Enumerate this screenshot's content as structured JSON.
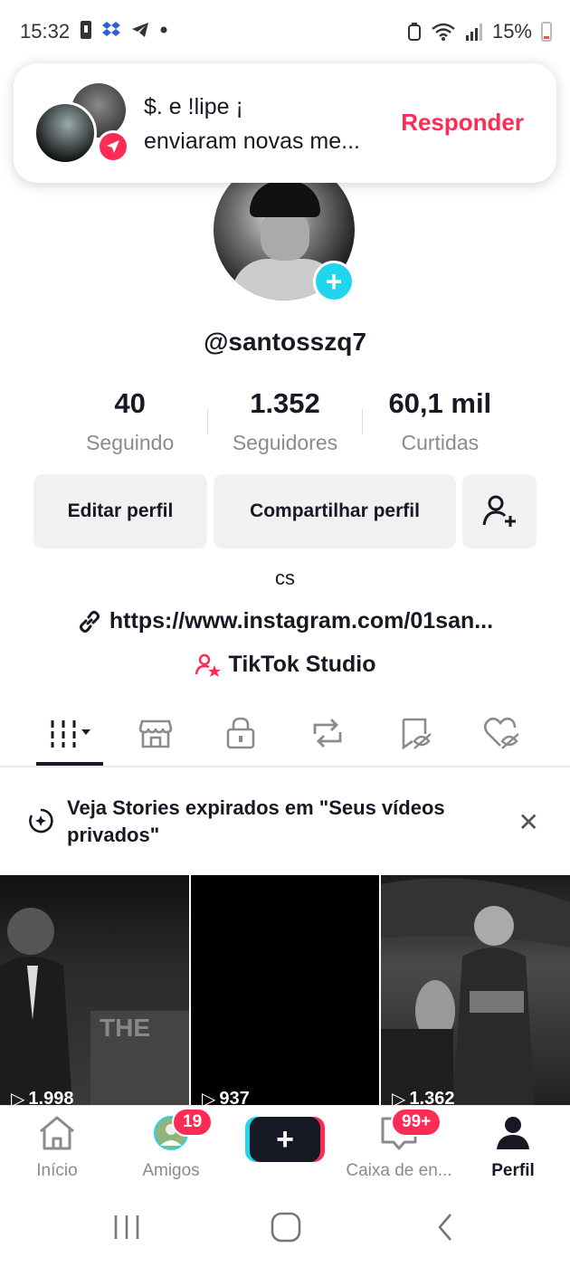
{
  "status_bar": {
    "time": "15:32",
    "battery": "15%",
    "icons": [
      "sim-icon",
      "dropbox-icon",
      "telegram-icon",
      "dot-icon",
      "alarm-icon",
      "wifi-icon",
      "signal-icon",
      "battery-icon"
    ]
  },
  "notification": {
    "title": "$. e !lipe ¡",
    "text": "enviaram novas me...",
    "reply_label": "Responder",
    "accent": "#fe2c55"
  },
  "profile": {
    "username": "@santosszq7",
    "stats": [
      {
        "value": "40",
        "label": "Seguindo"
      },
      {
        "value": "1.352",
        "label": "Seguidores"
      },
      {
        "value": "60,1 mil",
        "label": "Curtidas"
      }
    ],
    "edit_label": "Editar perfil",
    "share_label": "Compartilhar perfil",
    "bio": "cs",
    "link": "https://www.instagram.com/01san...",
    "studio_label": "TikTok Studio"
  },
  "tabs": [
    "videos-grid-icon",
    "shop-icon",
    "lock-icon",
    "repost-icon",
    "saved-icon",
    "liked-hidden-icon"
  ],
  "stories_banner": {
    "text": "Veja Stories expirados em \"Seus vídeos privados\""
  },
  "videos": [
    {
      "count": "1.998"
    },
    {
      "count": "937"
    },
    {
      "count": "1.362"
    }
  ],
  "bottom_nav": {
    "home": "Início",
    "friends": "Amigos",
    "friends_badge": "19",
    "inbox": "Caixa de en...",
    "inbox_badge": "99+",
    "profile": "Perfil"
  },
  "colors": {
    "primary_red": "#fe2c55",
    "cyan": "#20d5ec",
    "text": "#161823",
    "muted": "#8a8b91"
  }
}
